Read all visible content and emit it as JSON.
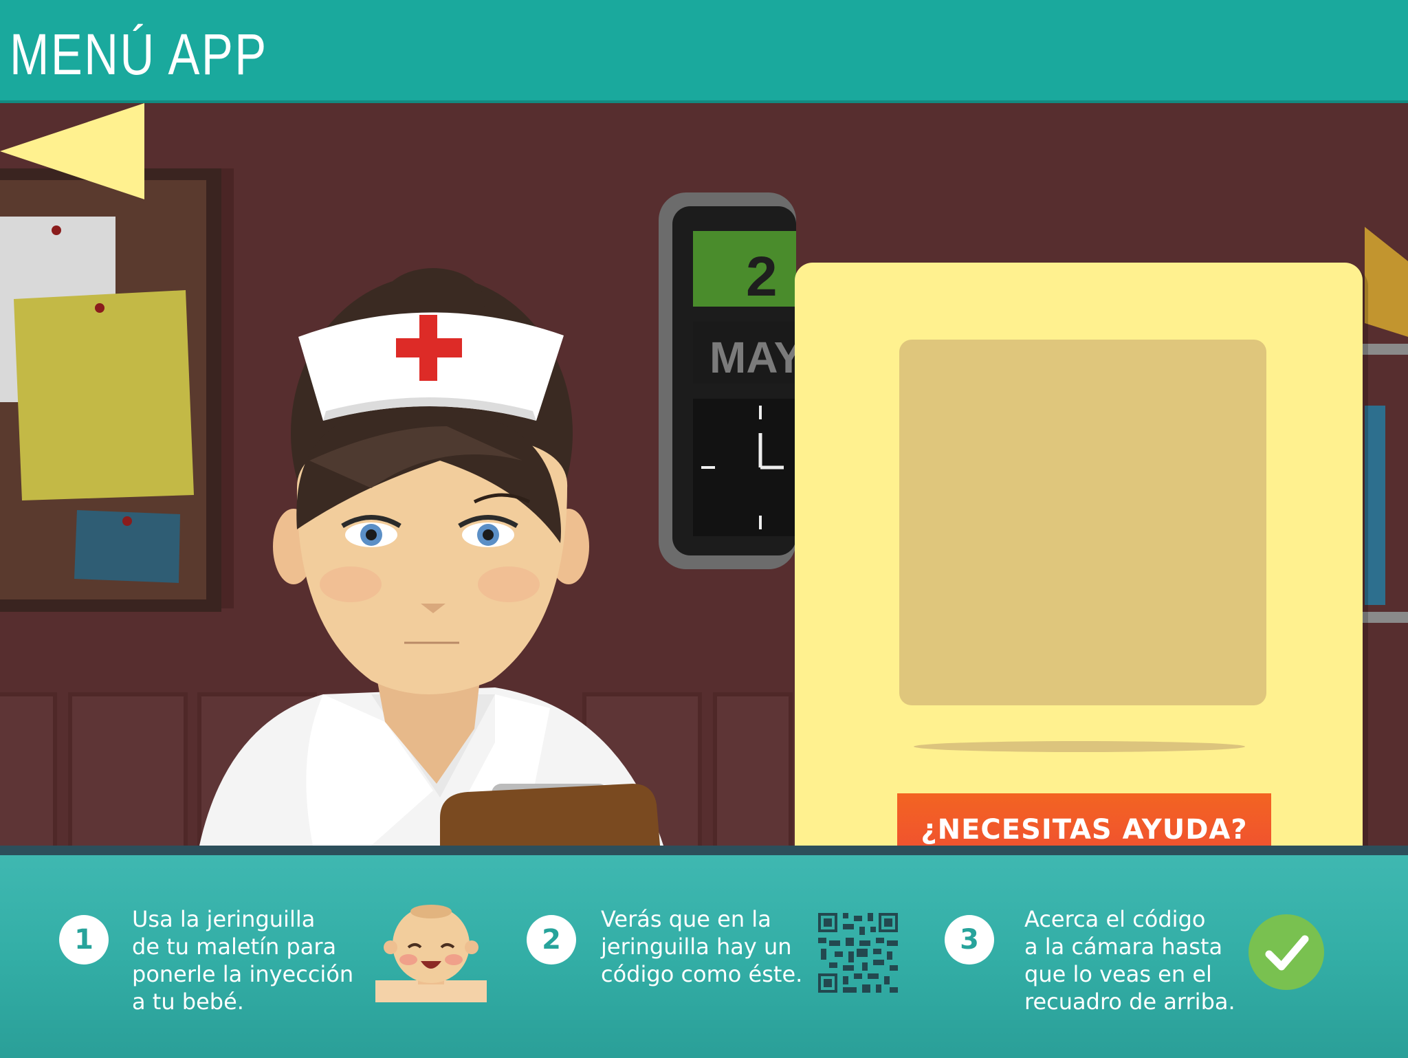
{
  "header": {
    "title": "MENÚ APP"
  },
  "scene": {
    "calendar_day": "2",
    "calendar_month": "MAY"
  },
  "popup": {
    "help_button_label": "¿NECESITAS AYUDA?"
  },
  "steps": [
    {
      "number": "1",
      "text": "Usa la jeringuilla\nde tu maletín para\nponerle la inyección\na tu bebé.",
      "icon": "baby-icon"
    },
    {
      "number": "2",
      "text": "Verás que en la\njeringuilla hay un\ncódigo como éste.",
      "icon": "qr-code-icon"
    },
    {
      "number": "3",
      "text": "Acerca el código\na la cámara hasta\nque lo veas en el\nrecuadro de arriba.",
      "icon": "checkmark-icon"
    }
  ],
  "colors": {
    "header_bg": "#1aa99d",
    "popup_bg": "#fff18f",
    "button_bg": "#f05a2c",
    "footer_bg": "#33aea6",
    "check_bg": "#79c150"
  }
}
